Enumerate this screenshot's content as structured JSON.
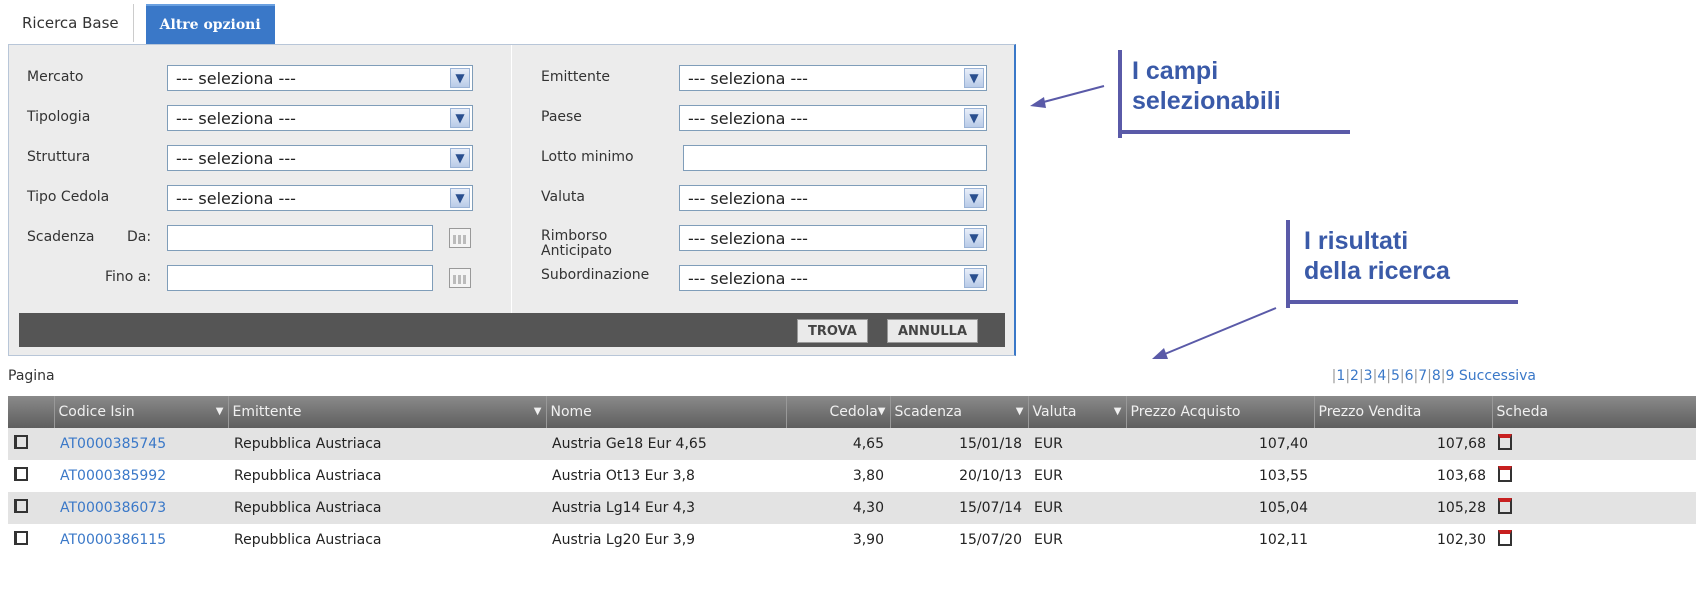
{
  "tabs": {
    "base": "Ricerca Base",
    "altre": "Altre opzioni"
  },
  "form": {
    "left": [
      {
        "label": "Mercato",
        "value": "--- seleziona ---"
      },
      {
        "label": "Tipologia",
        "value": "--- seleziona ---"
      },
      {
        "label": "Struttura",
        "value": "--- seleziona ---"
      },
      {
        "label": "Tipo Cedola",
        "value": "--- seleziona ---"
      }
    ],
    "scadenza_label": "Scadenza",
    "da_label": "Da:",
    "fino_label": "Fino a:",
    "right": [
      {
        "label": "Emittente",
        "value": "--- seleziona ---"
      },
      {
        "label": "Paese",
        "value": "--- seleziona ---"
      },
      {
        "label": "Valuta",
        "value": "--- seleziona ---"
      },
      {
        "label": "Rimborso Anticipato",
        "value": "--- seleziona ---"
      },
      {
        "label": "Subordinazione",
        "value": "--- seleziona ---"
      }
    ],
    "lotto_label": "Lotto minimo",
    "trova": "TROVA",
    "annulla": "ANNULLA"
  },
  "callouts": {
    "campi_line1": "I campi",
    "campi_line2": "selezionabili",
    "risultati_line1": "I risultati",
    "risultati_line2": "della ricerca"
  },
  "results": {
    "pagina_label": "Pagina",
    "pager": [
      "1",
      "2",
      "3",
      "4",
      "5",
      "6",
      "7",
      "8",
      "9"
    ],
    "next": "Successiva",
    "columns": [
      "Codice Isin",
      "Emittente",
      "Nome",
      "Cedola",
      "Scadenza",
      "Valuta",
      "Prezzo Acquisto",
      "Prezzo Vendita",
      "Scheda"
    ],
    "rows": [
      {
        "isin": "AT0000385745",
        "emittente": "Repubblica Austriaca",
        "nome": "Austria Ge18 Eur 4,65",
        "cedola": "4,65",
        "scadenza": "15/01/18",
        "valuta": "EUR",
        "acquisto": "107,40",
        "vendita": "107,68"
      },
      {
        "isin": "AT0000385992",
        "emittente": "Repubblica Austriaca",
        "nome": "Austria Ot13 Eur 3,8",
        "cedola": "3,80",
        "scadenza": "20/10/13",
        "valuta": "EUR",
        "acquisto": "103,55",
        "vendita": "103,68"
      },
      {
        "isin": "AT0000386073",
        "emittente": "Repubblica Austriaca",
        "nome": "Austria Lg14 Eur 4,3",
        "cedola": "4,30",
        "scadenza": "15/07/14",
        "valuta": "EUR",
        "acquisto": "105,04",
        "vendita": "105,28"
      },
      {
        "isin": "AT0000386115",
        "emittente": "Repubblica Austriaca",
        "nome": "Austria Lg20 Eur 3,9",
        "cedola": "3,90",
        "scadenza": "15/07/20",
        "valuta": "EUR",
        "acquisto": "102,11",
        "vendita": "102,30"
      }
    ]
  }
}
